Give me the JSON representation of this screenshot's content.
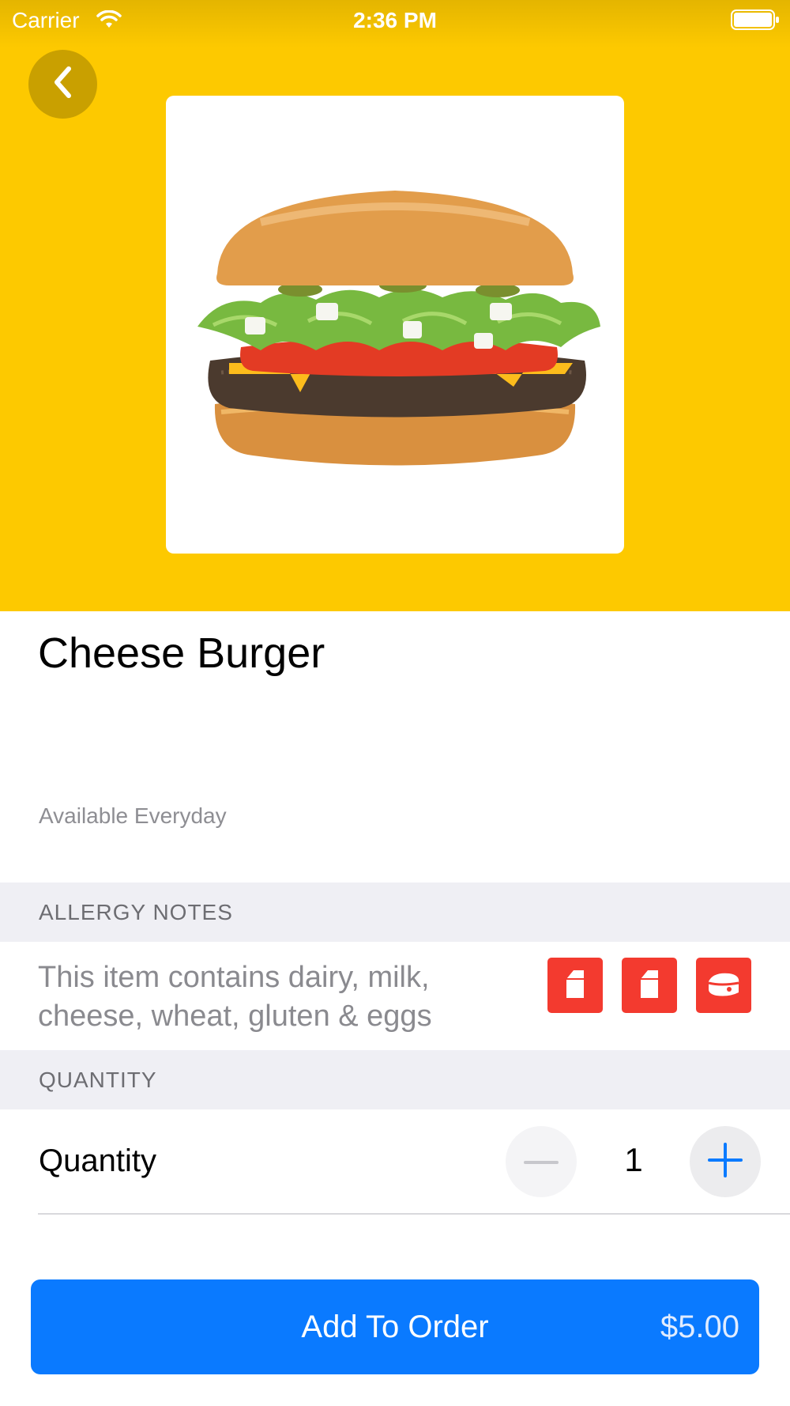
{
  "status_bar": {
    "carrier": "Carrier",
    "time": "2:36 PM",
    "wifi_icon": "wifi-icon",
    "battery_icon": "battery-icon"
  },
  "header": {
    "back_icon": "chevron-left-icon",
    "background_color": "#FDC900",
    "product_image": "cheeseburger-image"
  },
  "product": {
    "title": "Cheese Burger",
    "availability": "Available Everyday"
  },
  "allergy": {
    "section_title": "ALLERGY NOTES",
    "text": "This item contains dairy, milk, cheese, wheat, gluten & eggs",
    "badges": [
      "milk-carton-icon",
      "milk-carton-icon",
      "cheese-icon"
    ],
    "badge_color": "#F33A2F"
  },
  "quantity": {
    "section_title": "QUANTITY",
    "label": "Quantity",
    "value": "1",
    "decrement_icon": "minus-icon",
    "increment_icon": "plus-icon"
  },
  "order_button": {
    "label": "Add To Order",
    "price": "$5.00",
    "color": "#0A7AFF"
  }
}
